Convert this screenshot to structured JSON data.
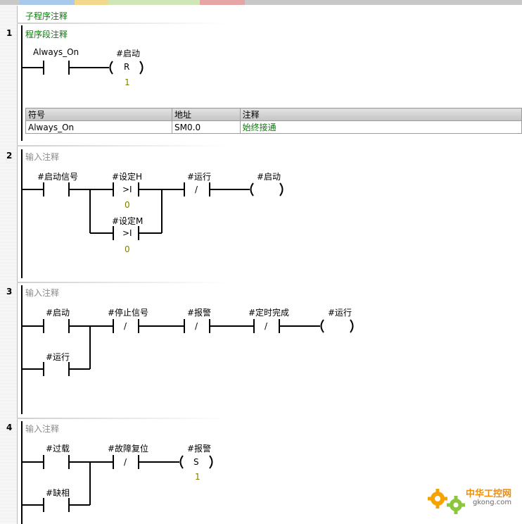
{
  "tabs": [
    {
      "label": "",
      "color": "#a9c9ea"
    },
    {
      "label": "",
      "color": "#f1d88b"
    },
    {
      "label": "",
      "color": "#cfe6b6"
    },
    {
      "label": "",
      "color": "#e6a5a5"
    }
  ],
  "subroutine_comment": "子程序注释",
  "networks": [
    {
      "number": "1",
      "comment": "程序段注释",
      "contact_label": "Always_On",
      "coil_label": "#启动",
      "coil_type": "R",
      "coil_value": "1",
      "symbol_table": {
        "headers": [
          "符号",
          "地址",
          "注释"
        ],
        "rows": [
          [
            "Always_On",
            "SM0.0",
            "始终接通"
          ]
        ]
      }
    },
    {
      "number": "2",
      "comment": "输入注释",
      "contact1": "#启动信号",
      "cmp1_label": "#设定H",
      "cmp1_op": ">I",
      "cmp1_value": "0",
      "cmp2_label": "#设定M",
      "cmp2_op": ">I",
      "cmp2_value": "0",
      "contact_nc": "#运行",
      "nc_symbol": "/",
      "coil": "#启动"
    },
    {
      "number": "3",
      "comment": "输入注释",
      "contact1": "#启动",
      "contact_branch": "#运行",
      "nc1": "#停止信号",
      "nc2": "#报警",
      "nc3": "#定时完成",
      "nc_symbol": "/",
      "coil": "#运行"
    },
    {
      "number": "4",
      "comment": "输入注释",
      "contact1": "#过载",
      "contact_branch": "#缺相",
      "nc1": "#故障复位",
      "nc_symbol": "/",
      "coil": "#报警",
      "coil_type": "S",
      "coil_value": "1"
    }
  ],
  "watermark": {
    "text": "中华工控网",
    "url": "gkong.com"
  }
}
